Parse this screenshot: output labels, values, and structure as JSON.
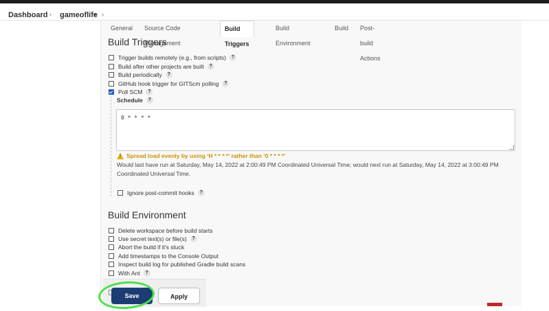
{
  "breadcrumb": {
    "items": [
      "Dashboard",
      "gameoflife"
    ],
    "separator": "›",
    "dropdown_icon": "chevron-down-icon"
  },
  "tabs": [
    "General",
    "Source Code Management",
    "Build Triggers",
    "Build Environment",
    "Build",
    "Post-build Actions"
  ],
  "active_tab": "Build Triggers",
  "build_triggers": {
    "title": "Build Triggers",
    "options": [
      {
        "label": "Trigger builds remotely (e.g., from scripts)",
        "checked": false
      },
      {
        "label": "Build after other projects are built",
        "checked": false
      },
      {
        "label": "Build periodically",
        "checked": false
      },
      {
        "label": "GitHub hook trigger for GITScm polling",
        "checked": false
      },
      {
        "label": "Poll SCM",
        "checked": true
      }
    ],
    "schedule_label": "Schedule",
    "schedule_value": "0 * * * *",
    "warning": "Spread load evenly by using ‘H * * * *’ rather than ‘0 * * * *’",
    "info": "Would last have run at Saturday, May 14, 2022 at 2:00:49 PM Coordinated Universal Time; would next run at Saturday, May 14, 2022 at 3:00:49 PM Coordinated Universal Time.",
    "ignore_hooks_label": "Ignore post-commit hooks",
    "ignore_hooks_checked": false
  },
  "build_environment": {
    "title": "Build Environment",
    "options": [
      {
        "label": "Delete workspace before build starts",
        "checked": false,
        "help": false
      },
      {
        "label": "Use secret text(s) or file(s)",
        "checked": false,
        "help": true
      },
      {
        "label": "Abort the build if it's stuck",
        "checked": false,
        "help": false
      },
      {
        "label": "Add timestamps to the Console Output",
        "checked": false,
        "help": false
      },
      {
        "label": "Inspect build log for published Gradle build scans",
        "checked": false,
        "help": false
      },
      {
        "label": "With Ant",
        "checked": false,
        "help": true
      }
    ]
  },
  "buttons": {
    "save": "Save",
    "apply": "Apply"
  },
  "help_glyph": "?",
  "colors": {
    "save_bg": "#1c3d73",
    "warning": "#c79400",
    "highlight": "#4de04d"
  }
}
